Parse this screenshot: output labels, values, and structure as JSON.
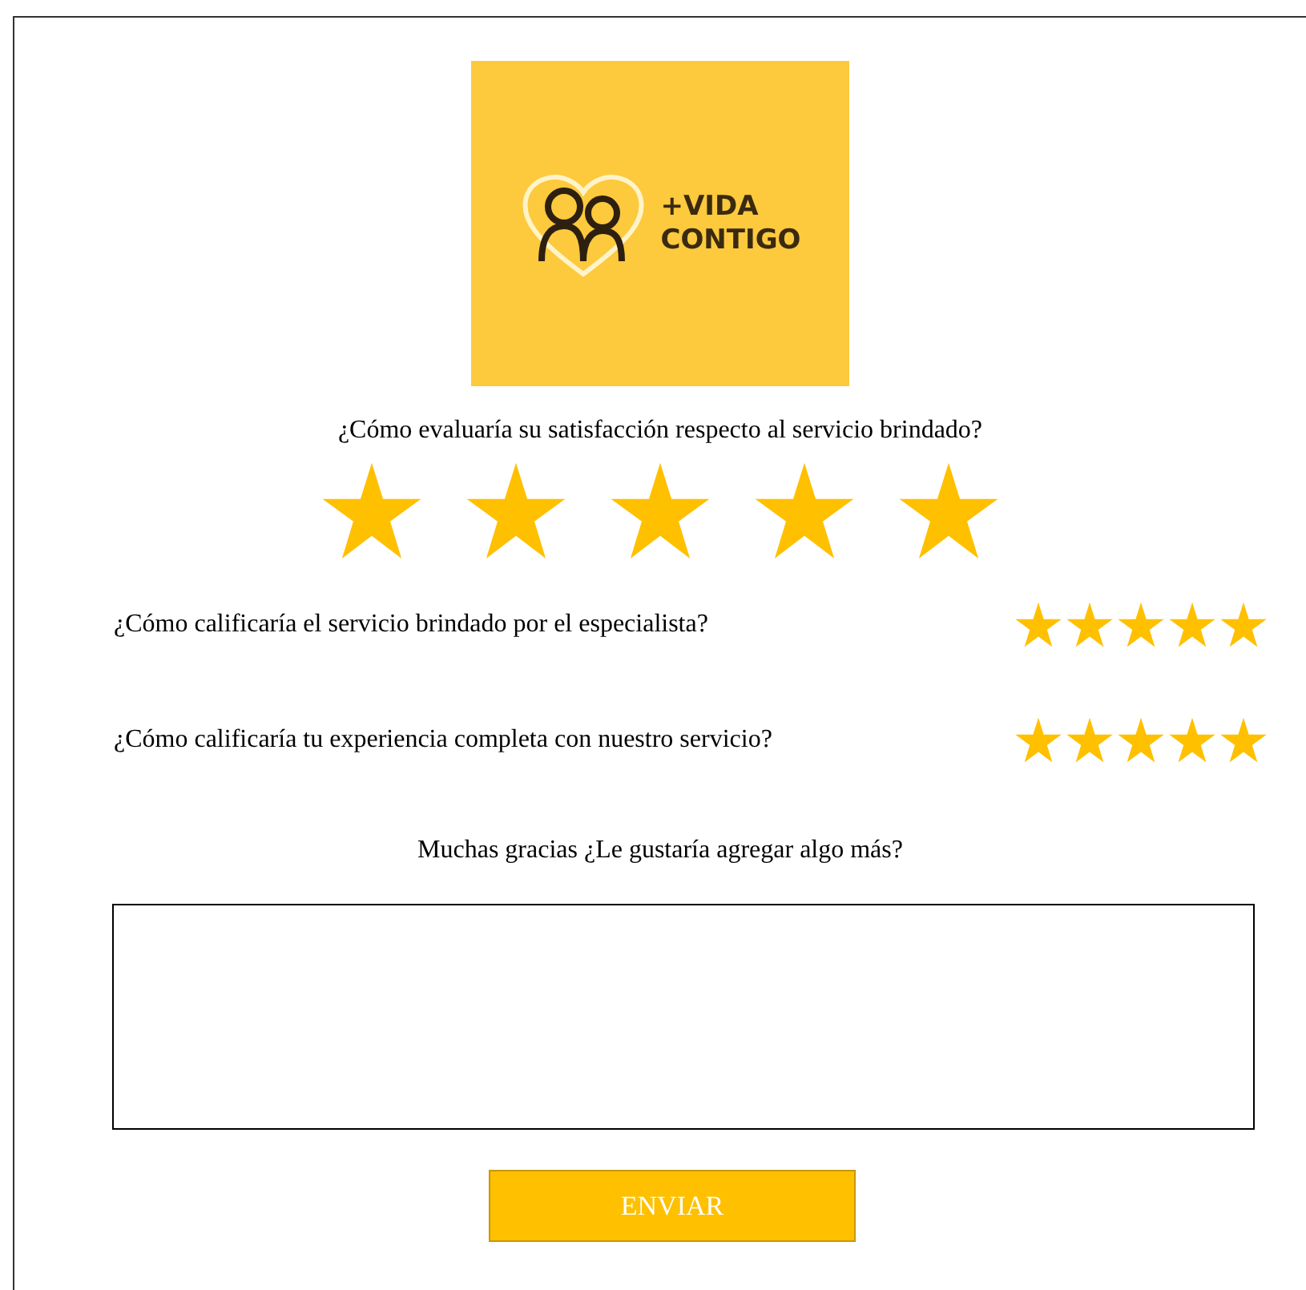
{
  "logo": {
    "line_1": "+VIDA",
    "line_2": "CONTIGO"
  },
  "questions": [
    {
      "kind": "large",
      "text": "¿Cómo evaluaría su satisfacción respecto al servicio brindado?",
      "stars": 5
    },
    {
      "kind": "inline",
      "text": "¿Cómo calificaría el servicio brindado por el especialista?",
      "stars": 5
    },
    {
      "kind": "inline",
      "text": "¿Cómo calificaría tu experiencia completa con nuestro servicio?",
      "stars": 5
    }
  ],
  "comment": {
    "prompt": "Muchas gracias ¿Le gustaría agregar algo más?"
  },
  "submit": {
    "label": "ENVIAR"
  }
}
